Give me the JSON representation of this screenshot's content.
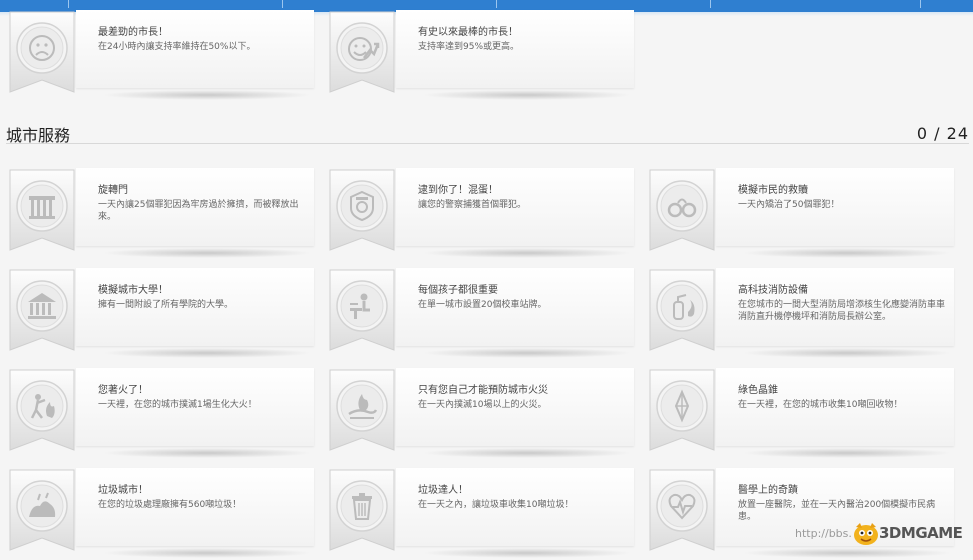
{
  "top_achievements": [
    {
      "icon": "sad-face-icon",
      "title": "最差勁的市長！",
      "desc": "在24小時內讓支持率維持在50%以下。"
    },
    {
      "icon": "happy-face-arrow-icon",
      "title": "有史以來最棒的市長！",
      "desc": "支持率達到95%或更高。"
    }
  ],
  "section": {
    "title": "城市服務",
    "count": "0 / 24"
  },
  "achievements": [
    {
      "icon": "jail-bars-icon",
      "title": "旋轉門",
      "desc": "一天內讓25個罪犯因為牢房過於擁擠，而被釋放出來。"
    },
    {
      "icon": "police-badge-icon",
      "title": "逮到你了！混蛋！",
      "desc": "讓您的警察捕獲首個罪犯。"
    },
    {
      "icon": "handcuffs-icon",
      "title": "模擬市民的救贖",
      "desc": "一天內矯治了50個罪犯！"
    },
    {
      "icon": "university-icon",
      "title": "模擬城市大學！",
      "desc": "擁有一間附設了所有學院的大學。"
    },
    {
      "icon": "student-desk-icon",
      "title": "每個孩子都很重要",
      "desc": "在單一城市設置20個校車站牌。"
    },
    {
      "icon": "fire-extinguisher-icon",
      "title": "高科技消防設備",
      "desc": "在您城市的一間大型消防局增添核生化應變消防車車消防直升機停機坪和消防局長辦公室。"
    },
    {
      "icon": "fire-figure-icon",
      "title": "您著火了！",
      "desc": "一天裡，在您的城市撲滅1場生化大火！"
    },
    {
      "icon": "hand-fire-icon",
      "title": "只有您自己才能預防城市火災",
      "desc": "在一天內撲滅10場以上的火災。"
    },
    {
      "icon": "crystal-icon",
      "title": "綠色晶錐",
      "desc": "在一天裡，在您的城市收集10噸回收物！"
    },
    {
      "icon": "garbage-pile-icon",
      "title": "垃圾城市！",
      "desc": "在您的垃圾處理廠擁有560噸垃圾！"
    },
    {
      "icon": "trash-can-icon",
      "title": "垃圾達人！",
      "desc": "在一天之內，讓垃圾車收集10噸垃圾！"
    },
    {
      "icon": "heart-pulse-icon",
      "title": "醫學上的奇蹟",
      "desc": "放置一座醫院，並在一天內醫治200個模擬市民病患。"
    }
  ],
  "watermark": {
    "url": "http://bbs.",
    "brand": "3DMGAME"
  }
}
